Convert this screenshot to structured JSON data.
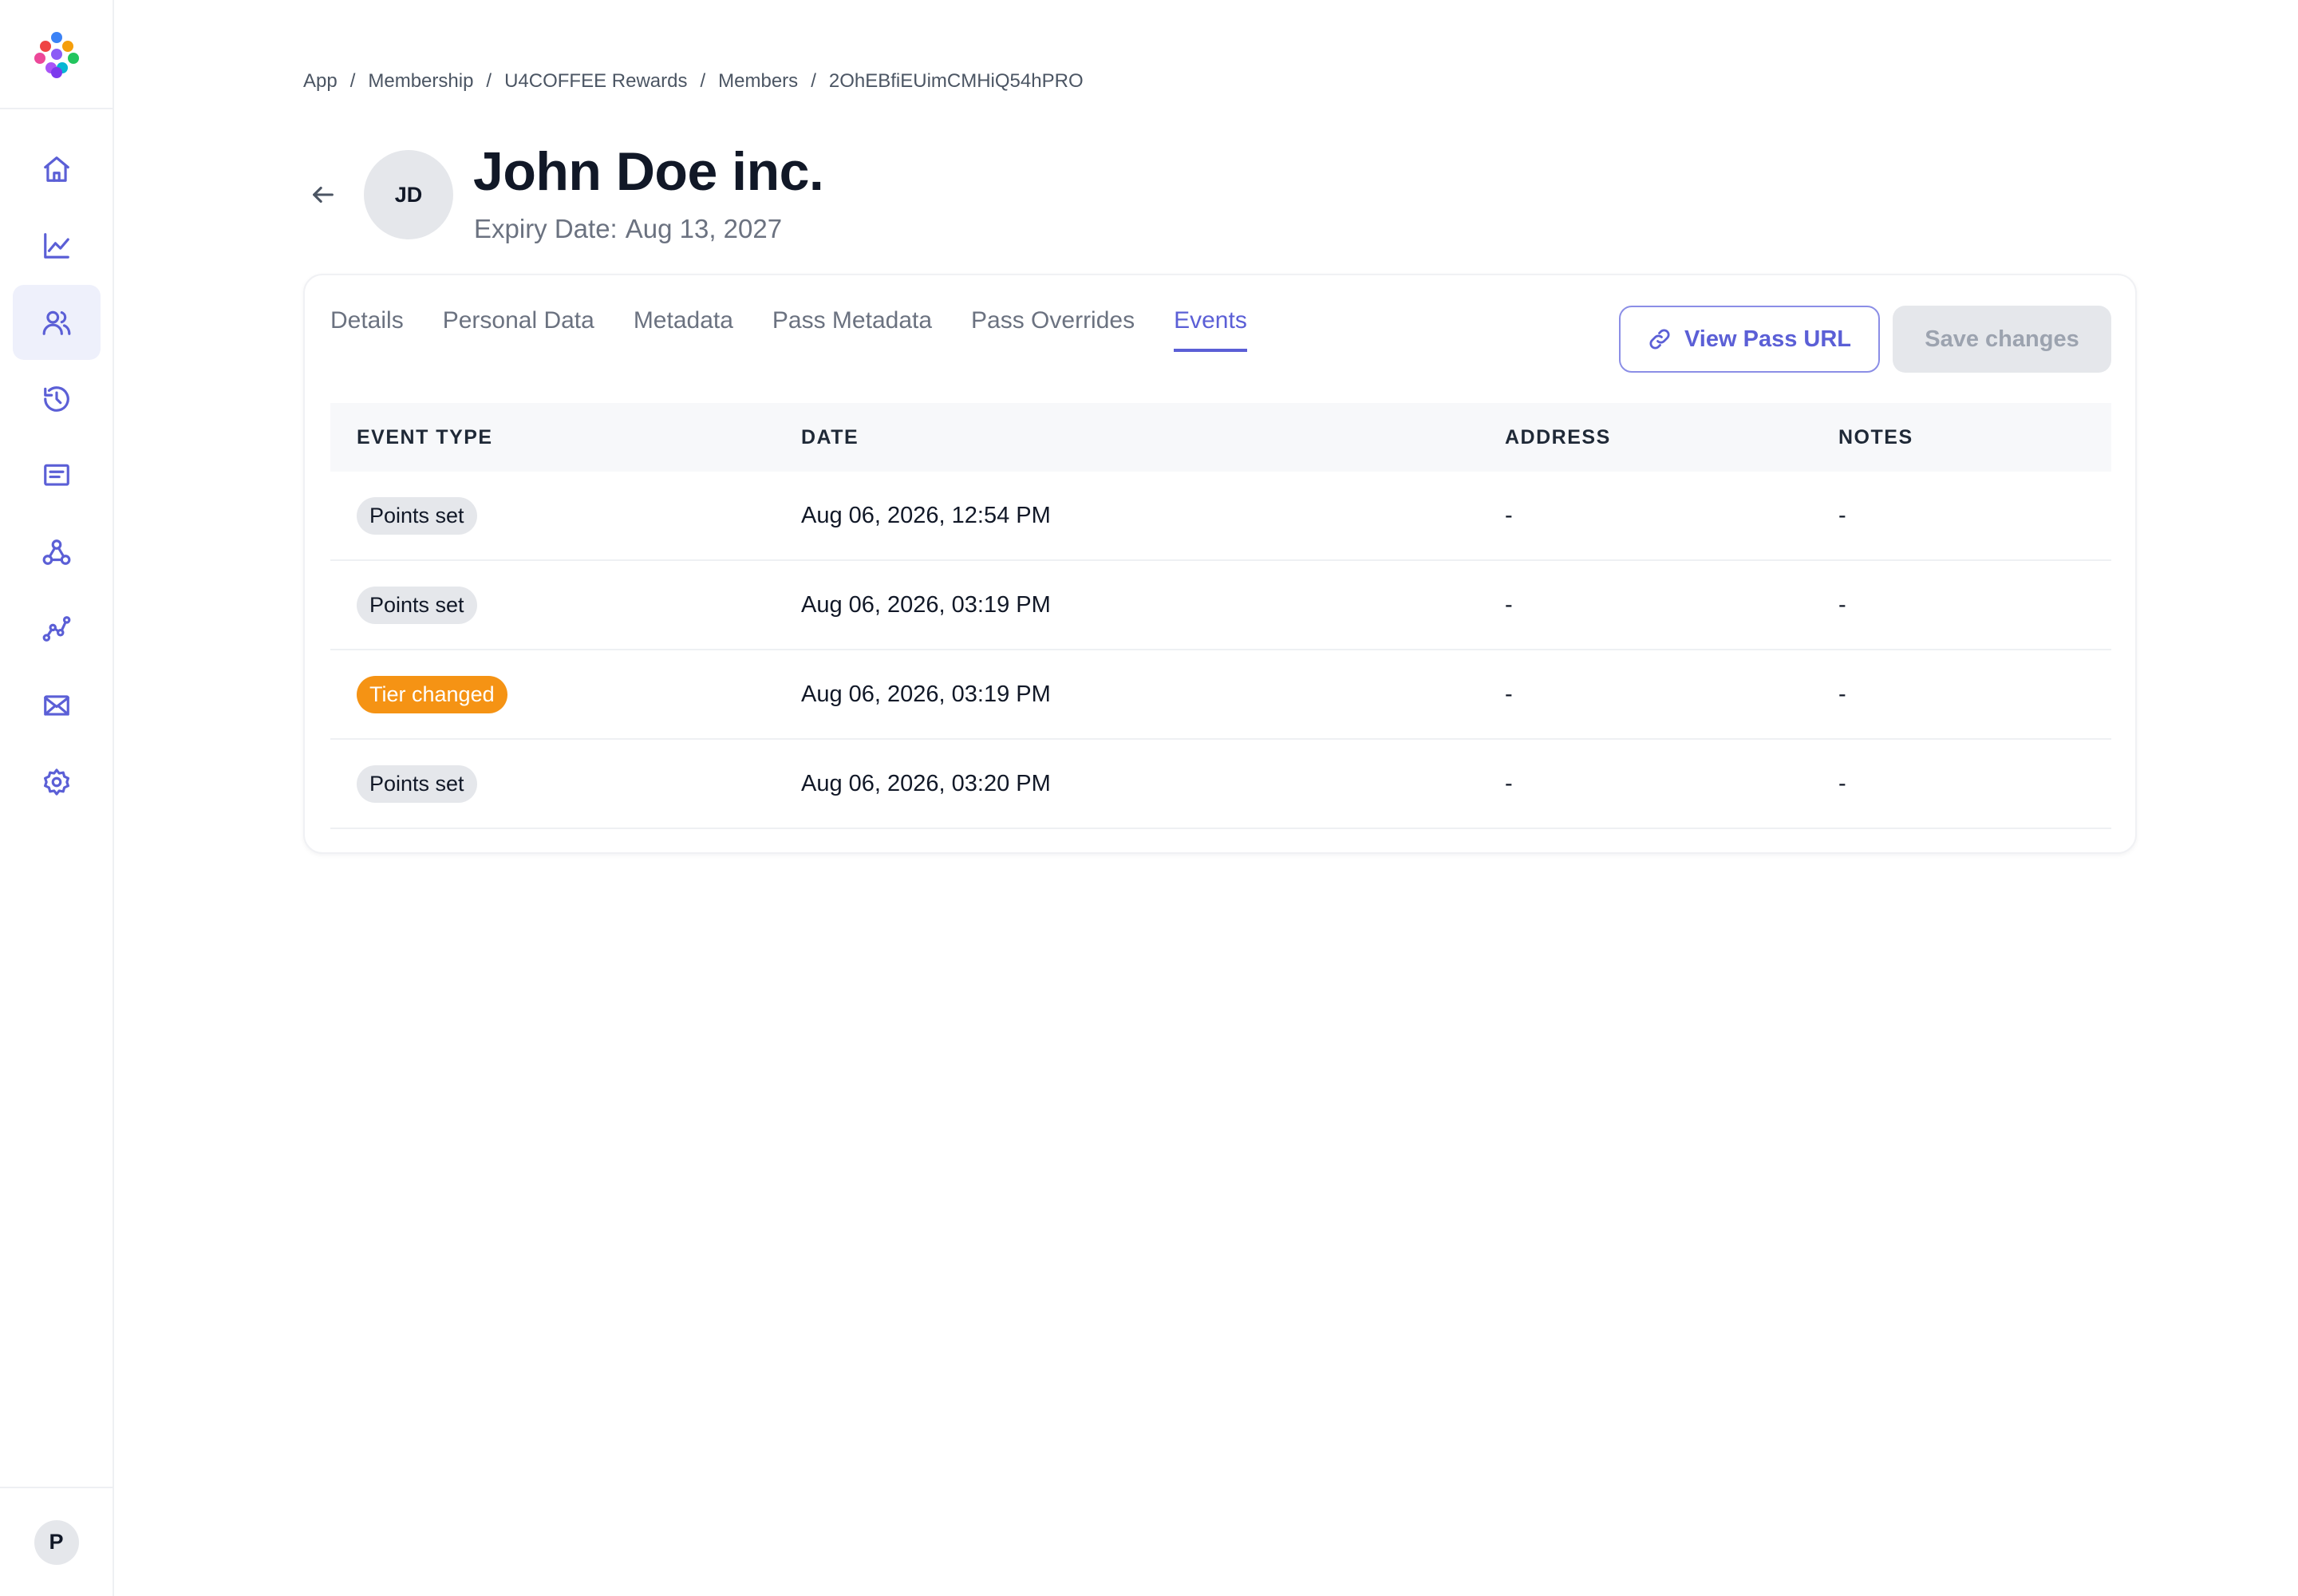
{
  "sidebar": {
    "items": [
      {
        "name": "home",
        "icon": "home-icon",
        "active": false
      },
      {
        "name": "analytics",
        "icon": "chart-line-icon",
        "active": false
      },
      {
        "name": "members",
        "icon": "users-icon",
        "active": true
      },
      {
        "name": "history",
        "icon": "history-icon",
        "active": false
      },
      {
        "name": "messages",
        "icon": "message-icon",
        "active": false
      },
      {
        "name": "webhooks",
        "icon": "webhook-icon",
        "active": false
      },
      {
        "name": "flows",
        "icon": "graph-icon",
        "active": false
      },
      {
        "name": "email",
        "icon": "mail-icon",
        "active": false
      },
      {
        "name": "settings",
        "icon": "gear-icon",
        "active": false
      }
    ],
    "user_initial": "P"
  },
  "breadcrumb": [
    "App",
    "Membership",
    "U4COFFEE Rewards",
    "Members",
    "2OhEBfiEUimCMHiQ54hPRO"
  ],
  "header": {
    "initials": "JD",
    "title": "John Doe inc.",
    "expiry_label": "Expiry Date:",
    "expiry_value": "Aug 13, 2027"
  },
  "tabs": [
    "Details",
    "Personal Data",
    "Metadata",
    "Pass Metadata",
    "Pass Overrides",
    "Events"
  ],
  "active_tab": "Events",
  "actions": {
    "view_pass_url": "View Pass URL",
    "save_changes": "Save changes"
  },
  "table": {
    "columns": [
      "EVENT TYPE",
      "DATE",
      "ADDRESS",
      "NOTES"
    ],
    "rows": [
      {
        "event_type": "Points set",
        "badge_style": "gray",
        "date": "Aug 06, 2026, 12:54 PM",
        "address": "-",
        "notes": "-"
      },
      {
        "event_type": "Points set",
        "badge_style": "gray",
        "date": "Aug 06, 2026, 03:19 PM",
        "address": "-",
        "notes": "-"
      },
      {
        "event_type": "Tier changed",
        "badge_style": "orange",
        "date": "Aug 06, 2026, 03:19 PM",
        "address": "-",
        "notes": "-"
      },
      {
        "event_type": "Points set",
        "badge_style": "gray",
        "date": "Aug 06, 2026, 03:20 PM",
        "address": "-",
        "notes": "-"
      }
    ]
  },
  "colors": {
    "accent": "#5b5fd6",
    "badge_gray": "#e5e7eb",
    "badge_orange": "#f59314",
    "logo": [
      "#ef4444",
      "#f59e0b",
      "#22c55e",
      "#3b82f6",
      "#8b5cf6",
      "#ec4899"
    ]
  }
}
